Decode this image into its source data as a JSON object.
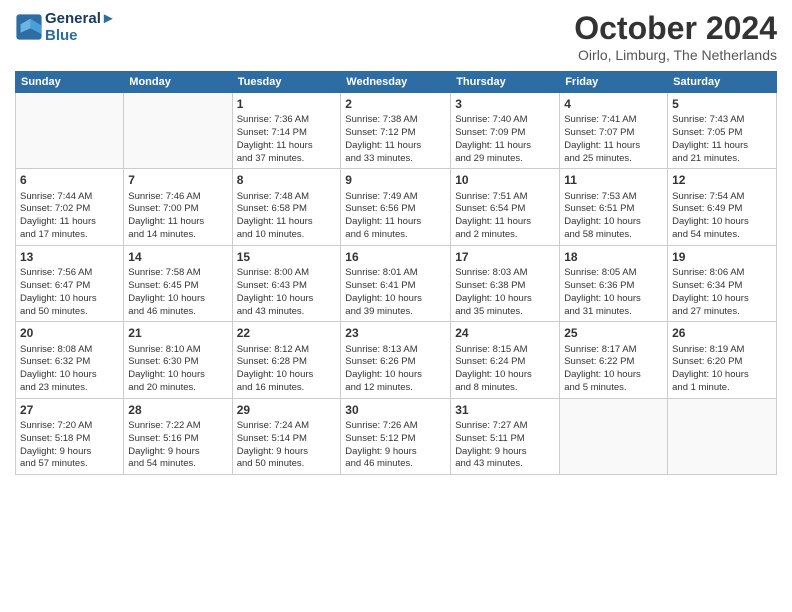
{
  "header": {
    "logo_line1": "General",
    "logo_line2": "Blue",
    "month": "October 2024",
    "location": "Oirlo, Limburg, The Netherlands"
  },
  "weekdays": [
    "Sunday",
    "Monday",
    "Tuesday",
    "Wednesday",
    "Thursday",
    "Friday",
    "Saturday"
  ],
  "weeks": [
    [
      {
        "day": "",
        "info": ""
      },
      {
        "day": "",
        "info": ""
      },
      {
        "day": "1",
        "info": "Sunrise: 7:36 AM\nSunset: 7:14 PM\nDaylight: 11 hours\nand 37 minutes."
      },
      {
        "day": "2",
        "info": "Sunrise: 7:38 AM\nSunset: 7:12 PM\nDaylight: 11 hours\nand 33 minutes."
      },
      {
        "day": "3",
        "info": "Sunrise: 7:40 AM\nSunset: 7:09 PM\nDaylight: 11 hours\nand 29 minutes."
      },
      {
        "day": "4",
        "info": "Sunrise: 7:41 AM\nSunset: 7:07 PM\nDaylight: 11 hours\nand 25 minutes."
      },
      {
        "day": "5",
        "info": "Sunrise: 7:43 AM\nSunset: 7:05 PM\nDaylight: 11 hours\nand 21 minutes."
      }
    ],
    [
      {
        "day": "6",
        "info": "Sunrise: 7:44 AM\nSunset: 7:02 PM\nDaylight: 11 hours\nand 17 minutes."
      },
      {
        "day": "7",
        "info": "Sunrise: 7:46 AM\nSunset: 7:00 PM\nDaylight: 11 hours\nand 14 minutes."
      },
      {
        "day": "8",
        "info": "Sunrise: 7:48 AM\nSunset: 6:58 PM\nDaylight: 11 hours\nand 10 minutes."
      },
      {
        "day": "9",
        "info": "Sunrise: 7:49 AM\nSunset: 6:56 PM\nDaylight: 11 hours\nand 6 minutes."
      },
      {
        "day": "10",
        "info": "Sunrise: 7:51 AM\nSunset: 6:54 PM\nDaylight: 11 hours\nand 2 minutes."
      },
      {
        "day": "11",
        "info": "Sunrise: 7:53 AM\nSunset: 6:51 PM\nDaylight: 10 hours\nand 58 minutes."
      },
      {
        "day": "12",
        "info": "Sunrise: 7:54 AM\nSunset: 6:49 PM\nDaylight: 10 hours\nand 54 minutes."
      }
    ],
    [
      {
        "day": "13",
        "info": "Sunrise: 7:56 AM\nSunset: 6:47 PM\nDaylight: 10 hours\nand 50 minutes."
      },
      {
        "day": "14",
        "info": "Sunrise: 7:58 AM\nSunset: 6:45 PM\nDaylight: 10 hours\nand 46 minutes."
      },
      {
        "day": "15",
        "info": "Sunrise: 8:00 AM\nSunset: 6:43 PM\nDaylight: 10 hours\nand 43 minutes."
      },
      {
        "day": "16",
        "info": "Sunrise: 8:01 AM\nSunset: 6:41 PM\nDaylight: 10 hours\nand 39 minutes."
      },
      {
        "day": "17",
        "info": "Sunrise: 8:03 AM\nSunset: 6:38 PM\nDaylight: 10 hours\nand 35 minutes."
      },
      {
        "day": "18",
        "info": "Sunrise: 8:05 AM\nSunset: 6:36 PM\nDaylight: 10 hours\nand 31 minutes."
      },
      {
        "day": "19",
        "info": "Sunrise: 8:06 AM\nSunset: 6:34 PM\nDaylight: 10 hours\nand 27 minutes."
      }
    ],
    [
      {
        "day": "20",
        "info": "Sunrise: 8:08 AM\nSunset: 6:32 PM\nDaylight: 10 hours\nand 23 minutes."
      },
      {
        "day": "21",
        "info": "Sunrise: 8:10 AM\nSunset: 6:30 PM\nDaylight: 10 hours\nand 20 minutes."
      },
      {
        "day": "22",
        "info": "Sunrise: 8:12 AM\nSunset: 6:28 PM\nDaylight: 10 hours\nand 16 minutes."
      },
      {
        "day": "23",
        "info": "Sunrise: 8:13 AM\nSunset: 6:26 PM\nDaylight: 10 hours\nand 12 minutes."
      },
      {
        "day": "24",
        "info": "Sunrise: 8:15 AM\nSunset: 6:24 PM\nDaylight: 10 hours\nand 8 minutes."
      },
      {
        "day": "25",
        "info": "Sunrise: 8:17 AM\nSunset: 6:22 PM\nDaylight: 10 hours\nand 5 minutes."
      },
      {
        "day": "26",
        "info": "Sunrise: 8:19 AM\nSunset: 6:20 PM\nDaylight: 10 hours\nand 1 minute."
      }
    ],
    [
      {
        "day": "27",
        "info": "Sunrise: 7:20 AM\nSunset: 5:18 PM\nDaylight: 9 hours\nand 57 minutes."
      },
      {
        "day": "28",
        "info": "Sunrise: 7:22 AM\nSunset: 5:16 PM\nDaylight: 9 hours\nand 54 minutes."
      },
      {
        "day": "29",
        "info": "Sunrise: 7:24 AM\nSunset: 5:14 PM\nDaylight: 9 hours\nand 50 minutes."
      },
      {
        "day": "30",
        "info": "Sunrise: 7:26 AM\nSunset: 5:12 PM\nDaylight: 9 hours\nand 46 minutes."
      },
      {
        "day": "31",
        "info": "Sunrise: 7:27 AM\nSunset: 5:11 PM\nDaylight: 9 hours\nand 43 minutes."
      },
      {
        "day": "",
        "info": ""
      },
      {
        "day": "",
        "info": ""
      }
    ]
  ]
}
